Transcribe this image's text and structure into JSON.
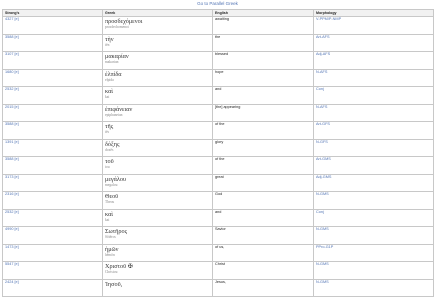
{
  "header": {
    "link_label": "Go to Parallel Greek"
  },
  "columns": {
    "strongs": "Strong's",
    "greek": "Greek",
    "english": "English",
    "morphology": "Morphology"
  },
  "rows": [
    {
      "strongs": "4327 [e]",
      "greek": "προσδεχόμενοι",
      "translit": "prosdechomenoi",
      "english": "awaiting",
      "morph": "V-PPM/P-NMP"
    },
    {
      "strongs": "3588 [e]",
      "greek": "τὴν",
      "translit": "tēn",
      "english": "the",
      "morph": "Art-AFS"
    },
    {
      "strongs": "3107 [e]",
      "greek": "μακαρίαν",
      "translit": "makarian",
      "english": "blessed",
      "morph": "Adj-AFS"
    },
    {
      "strongs": "1680 [e]",
      "greek": "ἐλπίδα",
      "translit": "elpida",
      "english": "hope",
      "morph": "N-AFS"
    },
    {
      "strongs": "2532 [e]",
      "greek": "καὶ",
      "translit": "kai",
      "english": "and",
      "morph": "Conj"
    },
    {
      "strongs": "2015 [e]",
      "greek": "ἐπιφάνειαν",
      "translit": "epiphaneian",
      "english": "[the] appearing",
      "morph": "N-AFS"
    },
    {
      "strongs": "3588 [e]",
      "greek": "τῆς",
      "translit": "tēs",
      "english": "of the",
      "morph": "Art-GFS"
    },
    {
      "strongs": "1391 [e]",
      "greek": "δόξης",
      "translit": "doxēs",
      "english": "glory",
      "morph": "N-GFS"
    },
    {
      "strongs": "3588 [e]",
      "greek": "τοῦ",
      "translit": "tou",
      "english": "of the",
      "morph": "Art-GMS"
    },
    {
      "strongs": "3173 [e]",
      "greek": "μεγάλου",
      "translit": "megalou",
      "english": "great",
      "morph": "Adj-GMS"
    },
    {
      "strongs": "2316 [e]",
      "greek": "Θεοῦ",
      "translit": "Theou",
      "english": "God",
      "morph": "N-GMS"
    },
    {
      "strongs": "2532 [e]",
      "greek": "καὶ",
      "translit": "kai",
      "english": "and",
      "morph": "Conj"
    },
    {
      "strongs": "4990 [e]",
      "greek": "Σωτῆρος",
      "translit": "Sōtēros",
      "english": "Savior",
      "morph": "N-GMS"
    },
    {
      "strongs": "1473 [e]",
      "greek": "ἡμῶν",
      "translit": "hēmōn",
      "english": "of us,",
      "morph": "PPro-G1P"
    },
    {
      "strongs": "5547 [e]",
      "greek": "Χριστοῦ ✠",
      "translit": "Christou",
      "english": "Christ",
      "morph": "N-GMS"
    },
    {
      "strongs": "2424 [e]",
      "greek": "Ἰησοῦ,",
      "translit": "",
      "english": "Jesus,",
      "morph": "N-GMS"
    }
  ]
}
